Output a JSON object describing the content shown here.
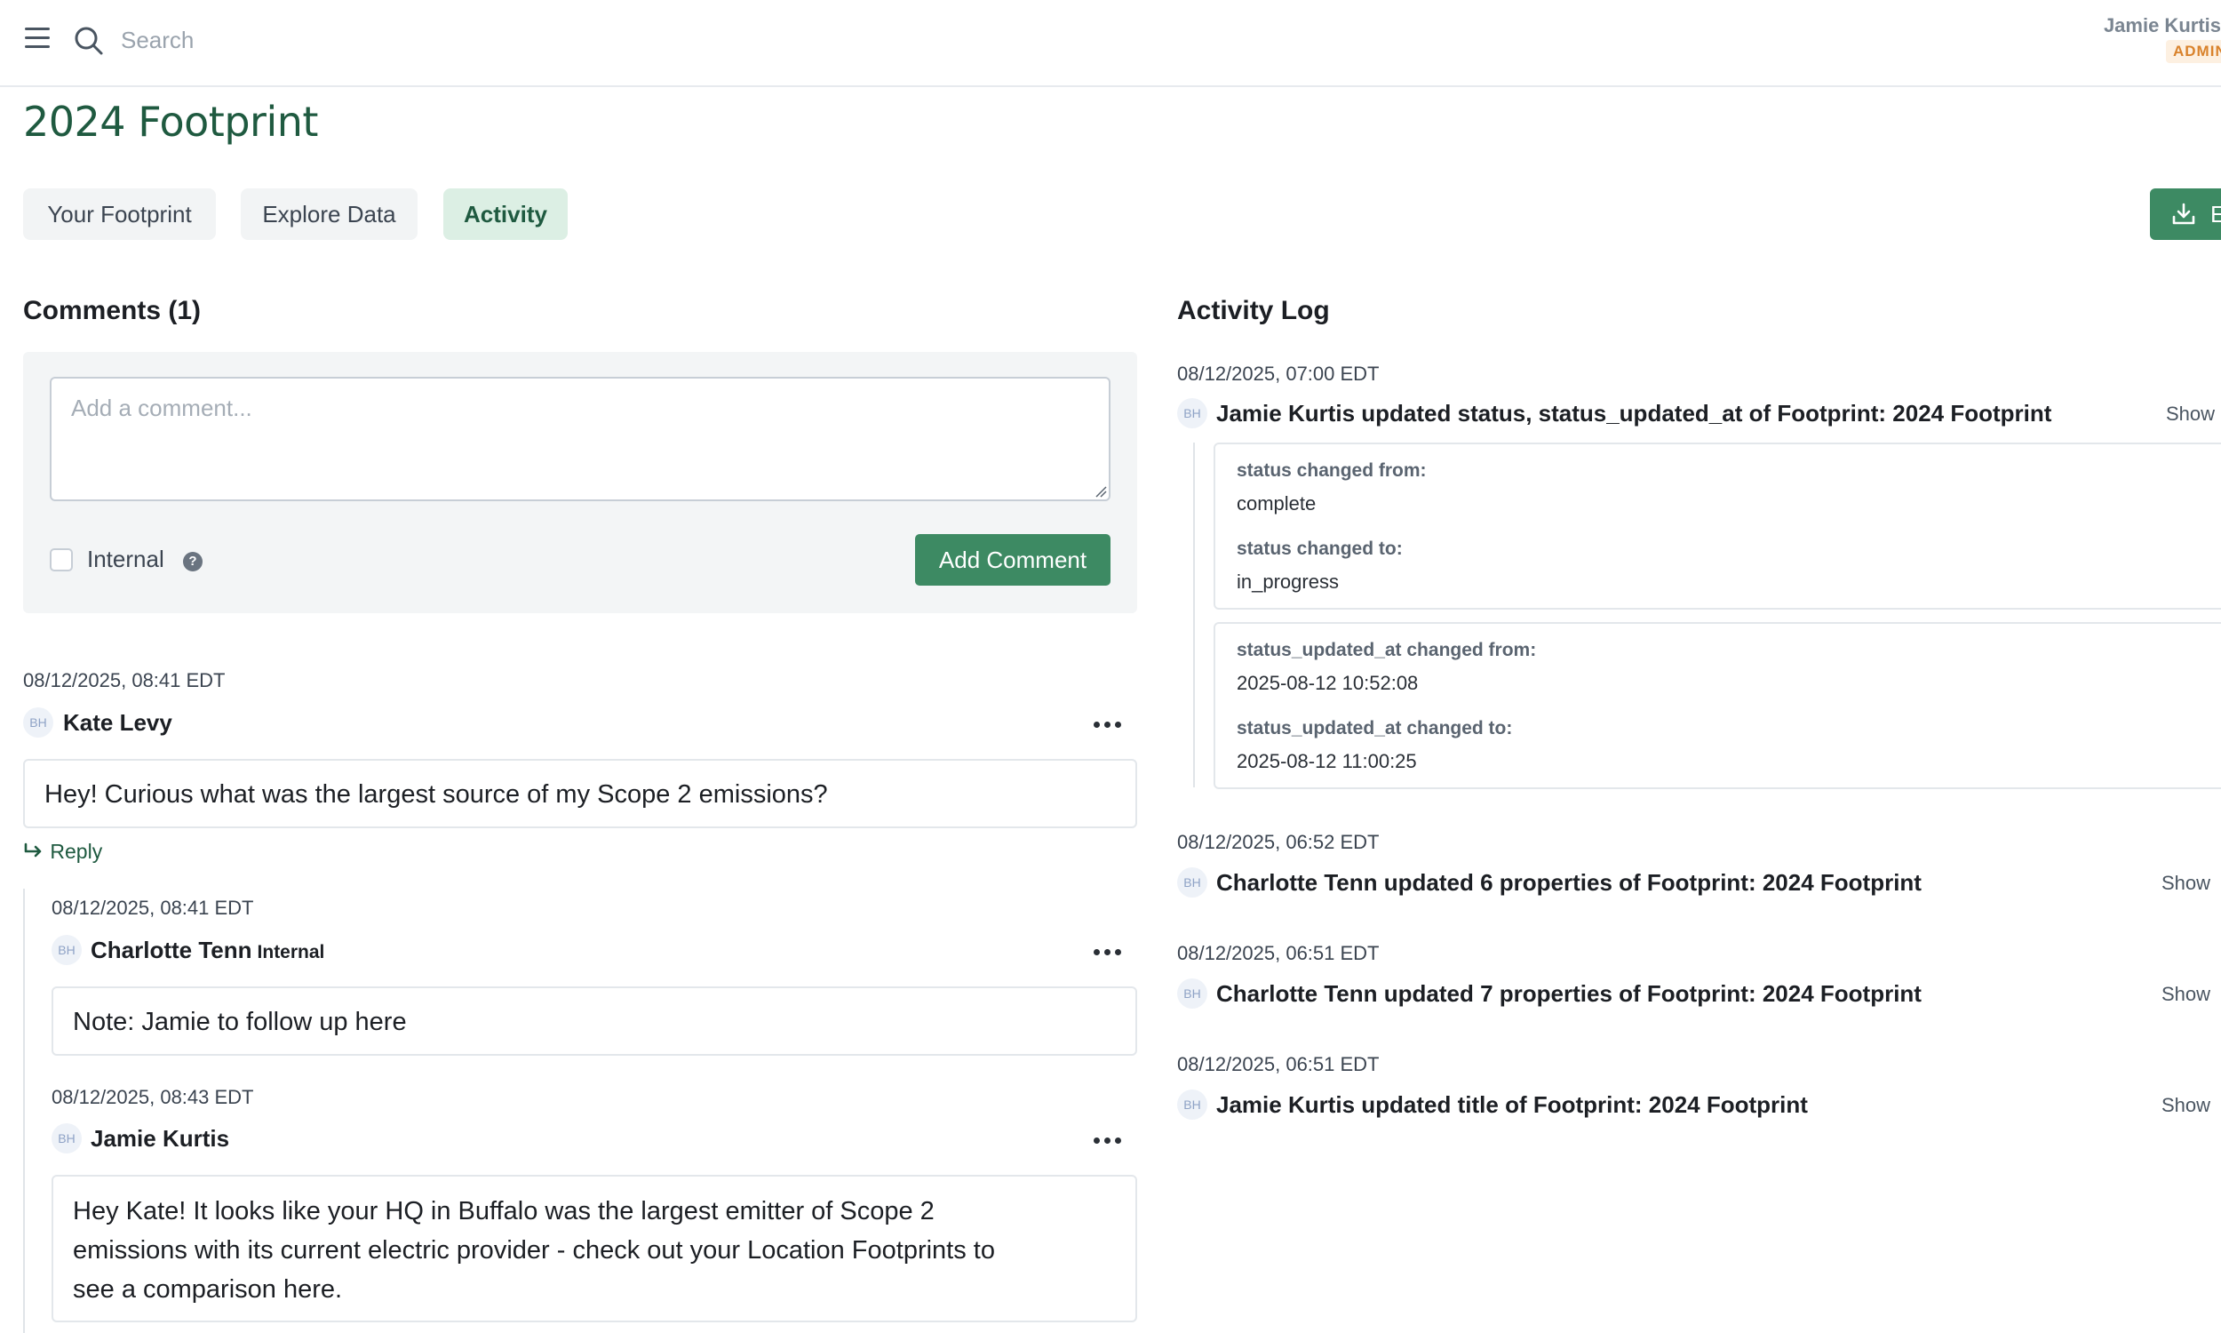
{
  "topbar": {
    "search_placeholder": "Search",
    "user_name": "Jamie Kurtis",
    "user_role": "ADMIN"
  },
  "page_title": "2024 Footprint",
  "tabs": [
    {
      "label": "Your Footprint",
      "active": false
    },
    {
      "label": "Explore Data",
      "active": false
    },
    {
      "label": "Activity",
      "active": true
    }
  ],
  "download_button_label": "E",
  "comments": {
    "heading": "Comments (1)",
    "placeholder": "Add a comment...",
    "internal_label": "Internal",
    "help_icon_text": "?",
    "add_button": "Add Comment",
    "reply_label": "Reply",
    "thread": [
      {
        "timestamp": "08/12/2025, 08:41 EDT",
        "avatar": "BH",
        "author": "Kate Levy",
        "tag": "",
        "text": "Hey! Curious what was the largest source of my Scope 2 emissions?"
      },
      {
        "timestamp": "08/12/2025, 08:41 EDT",
        "avatar": "BH",
        "author": "Charlotte Tenn",
        "tag": "Internal",
        "text": "Note: Jamie to follow up here"
      },
      {
        "timestamp": "08/12/2025, 08:43 EDT",
        "avatar": "BH",
        "author": "Jamie Kurtis",
        "tag": "",
        "text_lines": [
          "Hey Kate! It looks like your HQ in Buffalo was the largest emitter of Scope 2",
          "emissions with its current electric provider - check out your Location Footprints to",
          "see a comparison here."
        ]
      }
    ]
  },
  "activity_log": {
    "heading": "Activity Log",
    "entries": [
      {
        "timestamp": "08/12/2025, 07:00 EDT",
        "avatar": "BH",
        "text": "Jamie Kurtis updated status, status_updated_at of Footprint: 2024 Footprint",
        "show": "Show",
        "changes": [
          {
            "from_key": "status changed from:",
            "from_val": "complete",
            "to_key": "status changed to:",
            "to_val": "in_progress"
          },
          {
            "from_key": "status_updated_at changed from:",
            "from_val": "2025-08-12 10:52:08",
            "to_key": "status_updated_at changed to:",
            "to_val": "2025-08-12 11:00:25"
          }
        ]
      },
      {
        "timestamp": "08/12/2025, 06:52 EDT",
        "avatar": "BH",
        "text": "Charlotte Tenn updated 6 properties of Footprint: 2024 Footprint",
        "show": "Show"
      },
      {
        "timestamp": "08/12/2025, 06:51 EDT",
        "avatar": "BH",
        "text": "Charlotte Tenn updated 7 properties of Footprint: 2024 Footprint",
        "show": "Show"
      },
      {
        "timestamp": "08/12/2025, 06:51 EDT",
        "avatar": "BH",
        "text": "Jamie Kurtis updated title of Footprint: 2024 Footprint",
        "show": "Show"
      }
    ]
  }
}
